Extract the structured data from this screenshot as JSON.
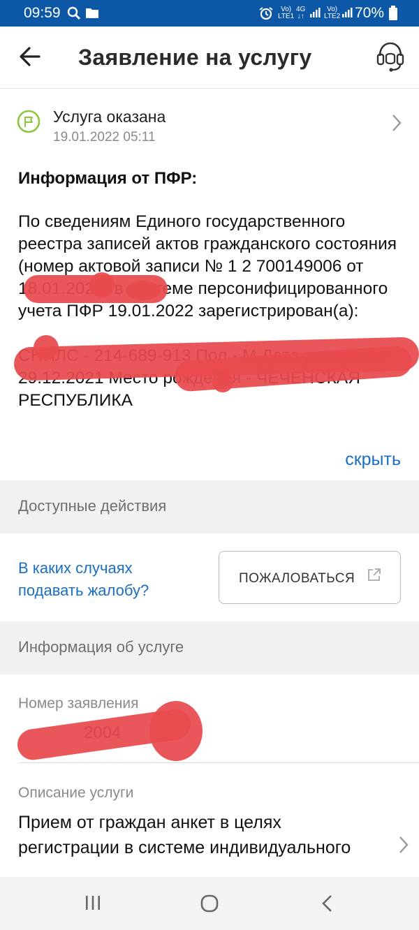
{
  "status_bar": {
    "time": "09:59",
    "battery": "70%",
    "net_sim1_top": "Vo)",
    "net_sim1_bottom": "LTE1",
    "net_4g": "4G",
    "net_sim2_top": "Vo)",
    "net_sim2_bottom": "LTE2"
  },
  "header": {
    "title": "Заявление на услугу"
  },
  "service_status": {
    "title": "Услуга оказана",
    "date": "19.01.2022 05:11"
  },
  "info": {
    "heading": "Информация от ПФР:",
    "body": "По сведениям Единого государственного реестра записей актов гражданского состояния (номер актовой записи № 1        2         700149006 от 18.01.2022) в системе персонифицированного учета ПФР 19.01.2022 зарегистрирован(а):\n\nСНИЛС - 214-689-913      Пол - М Дата рождения - 29.12.2021 Место рождения - ЧЕЧЕНСКАЯ РЕСПУБЛИКА",
    "hide_link": "скрыть"
  },
  "actions": {
    "section_title": "Доступные действия",
    "faq_link": "В каких случаях подавать жалобу?",
    "complain_button": "ПОЖАЛОВАТЬСЯ"
  },
  "service_info": {
    "section_title": "Информация об услуге",
    "number_label": "Номер заявления",
    "number_value": "2004",
    "description_label": "Описание услуги",
    "description_value": "Прием от граждан анкет в целях регистрации в системе индивидуального"
  },
  "colors": {
    "primary": "#0d58a6",
    "link": "#1a6fc4",
    "success": "#8cc63f",
    "redaction": "#e84a4f"
  }
}
